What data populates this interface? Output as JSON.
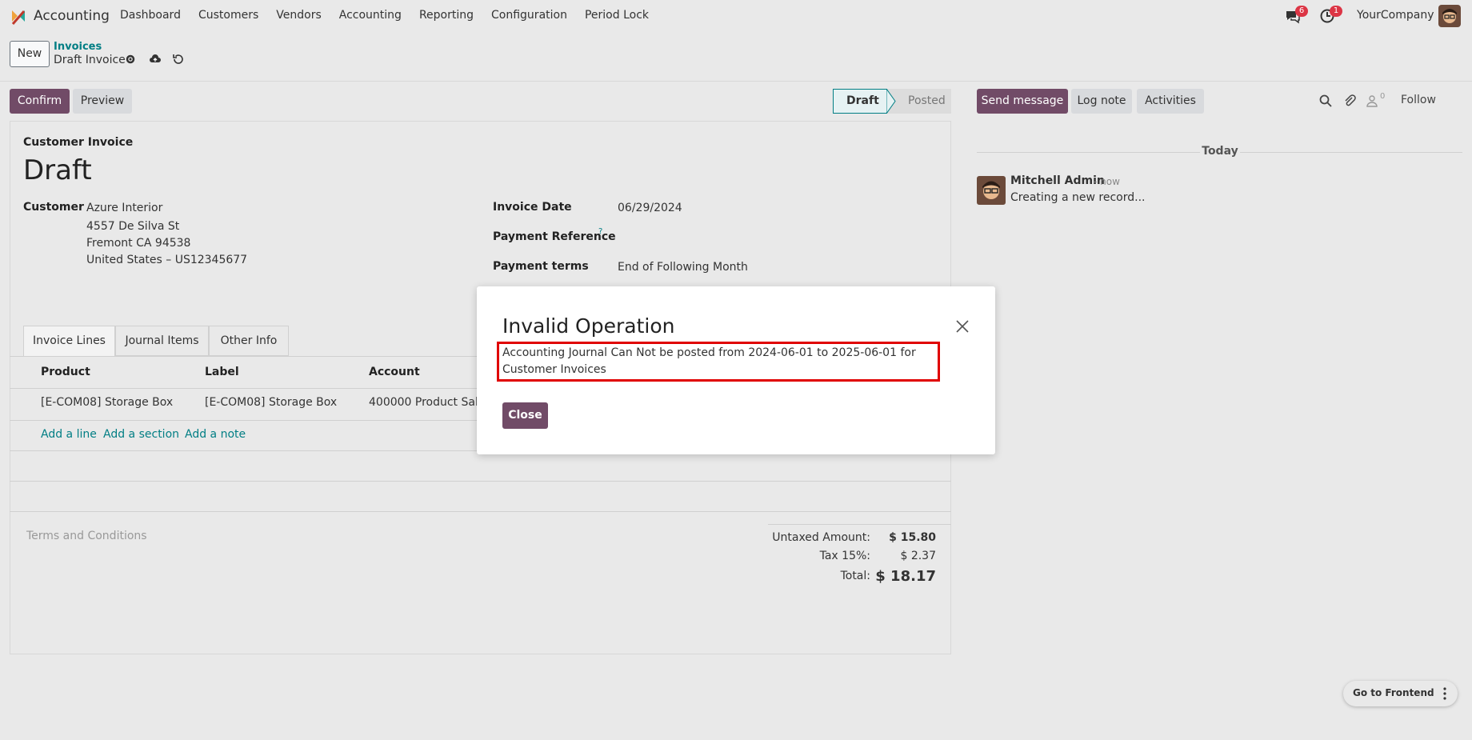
{
  "navbar": {
    "app_name": "Accounting",
    "menu": [
      "Dashboard",
      "Customers",
      "Vendors",
      "Accounting",
      "Reporting",
      "Configuration",
      "Period Lock"
    ],
    "messages_badge": "6",
    "activities_badge": "1",
    "company": "YourCompany"
  },
  "control_panel": {
    "new_label": "New",
    "breadcrumb_parent": "Invoices",
    "breadcrumb_current": "Draft Invoice",
    "confirm_label": "Confirm",
    "preview_label": "Preview",
    "status_draft": "Draft",
    "status_posted": "Posted"
  },
  "form": {
    "doc_type": "Customer Invoice",
    "title": "Draft",
    "customer_label": "Customer",
    "customer_name": "Azure Interior",
    "address_line1": "4557 De Silva St",
    "address_line2": "Fremont CA 94538",
    "address_line3": "United States – US12345677",
    "invoice_date_label": "Invoice Date",
    "invoice_date": "06/29/2024",
    "payment_ref_label": "Payment Reference",
    "payment_ref_help": "?",
    "payment_terms_label": "Payment terms",
    "payment_terms": "End of Following Month",
    "tabs": [
      "Invoice Lines",
      "Journal Items",
      "Other Info"
    ],
    "columns": [
      "Product",
      "Label",
      "Account"
    ],
    "line": {
      "product": "[E-COM08] Storage Box",
      "label": "[E-COM08] Storage Box",
      "account": "400000 Product Sales"
    },
    "add_line": "Add a line",
    "add_section": "Add a section",
    "add_note": "Add a note",
    "terms_placeholder": "Terms and Conditions",
    "untaxed_label": "Untaxed Amount:",
    "untaxed_value": "$ 15.80",
    "tax_label": "Tax 15%:",
    "tax_value": "$ 2.37",
    "total_label": "Total:",
    "total_value": "$ 18.17"
  },
  "chatter": {
    "send_message": "Send message",
    "log_note": "Log note",
    "activities": "Activities",
    "followers_count": "0",
    "follow": "Follow",
    "today": "Today",
    "author": "Mitchell Admin",
    "time": "- now",
    "body": "Creating a new record..."
  },
  "footer": {
    "go_frontend": "Go to Frontend"
  },
  "modal": {
    "title": "Invalid Operation",
    "message": "Accounting Journal Can Not be posted from 2024-06-01 to 2025-06-01 for Customer Invoices",
    "close_label": "Close"
  },
  "colors": {
    "primary": "#714b67",
    "link": "#017e84",
    "highlight": "#e00000",
    "badge": "#dc3545"
  }
}
